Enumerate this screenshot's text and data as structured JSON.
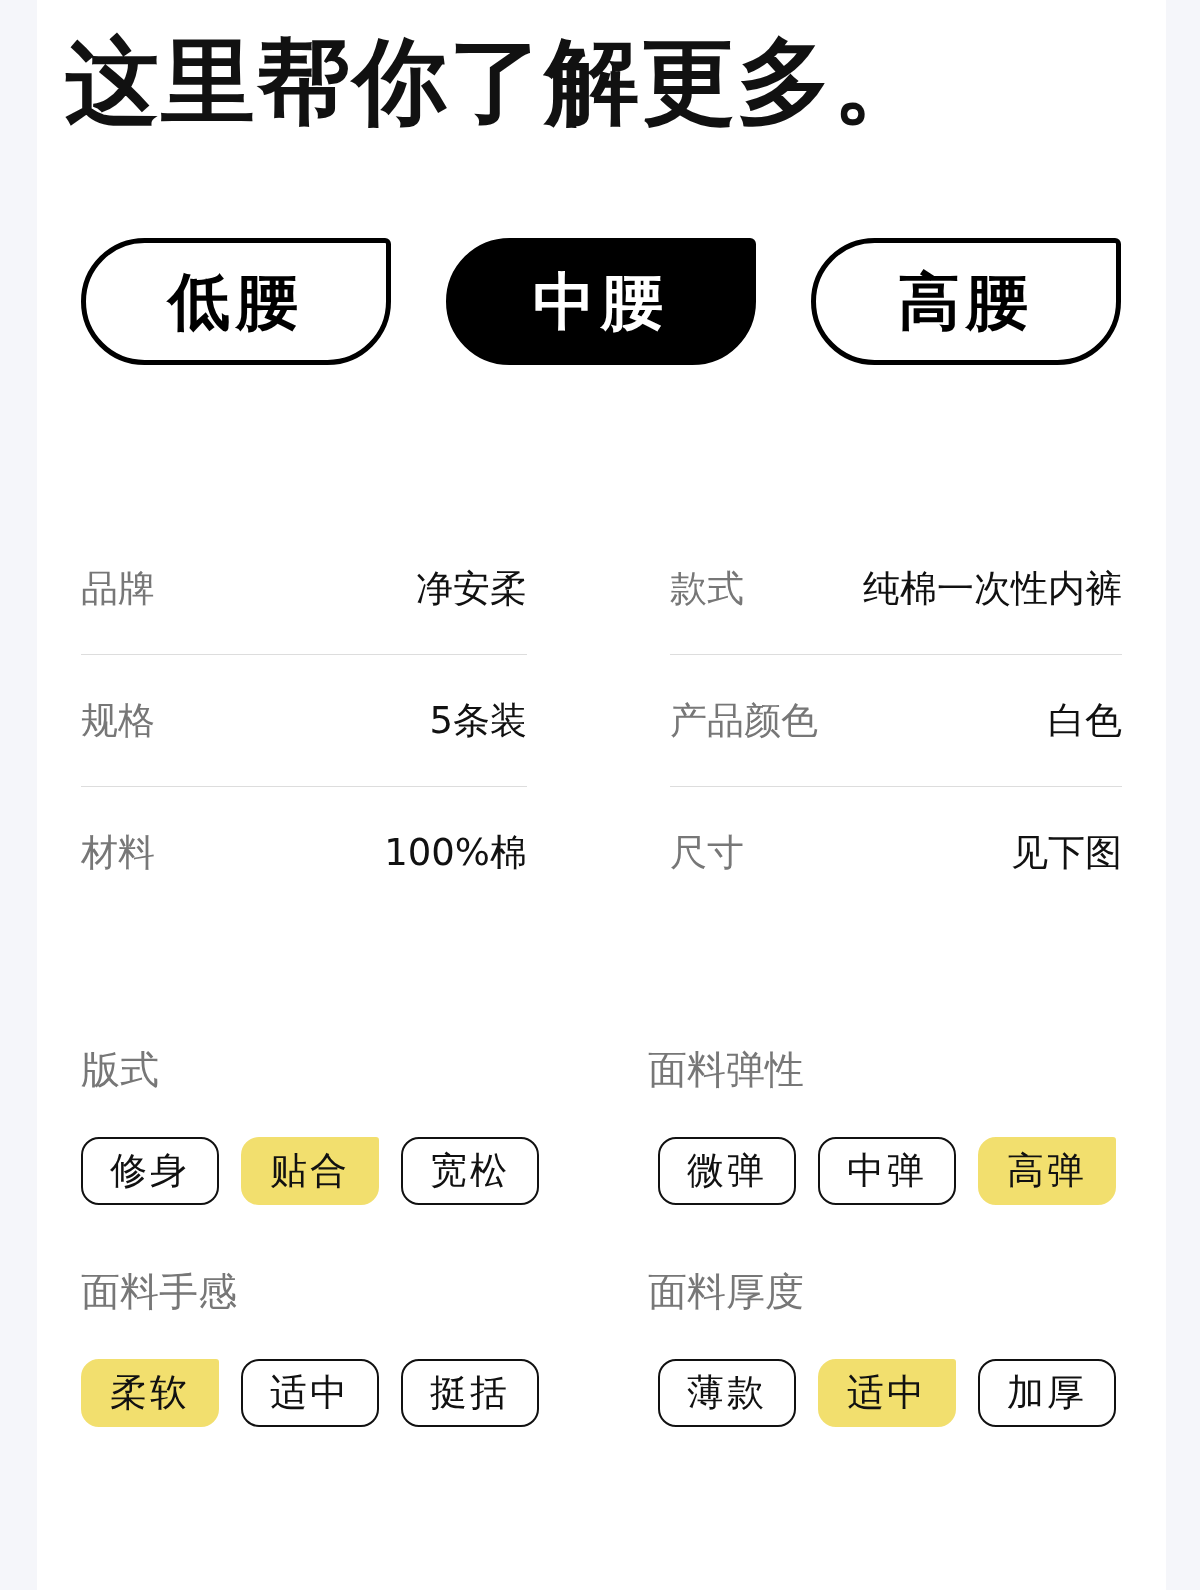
{
  "title": "这里帮你了解更多。",
  "waist_options": [
    {
      "label": "低腰",
      "selected": false
    },
    {
      "label": "中腰",
      "selected": true
    },
    {
      "label": "高腰",
      "selected": false
    }
  ],
  "specs": [
    {
      "label": "品牌",
      "value": "净安柔"
    },
    {
      "label": "款式",
      "value": "纯棉一次性内裤"
    },
    {
      "label": "规格",
      "value": "5条装"
    },
    {
      "label": "产品颜色",
      "value": "白色"
    },
    {
      "label": "材料",
      "value": "100%棉"
    },
    {
      "label": "尺寸",
      "value": "见下图"
    }
  ],
  "attributes": [
    {
      "title": "版式",
      "options": [
        {
          "label": "修身",
          "selected": false
        },
        {
          "label": "贴合",
          "selected": true
        },
        {
          "label": "宽松",
          "selected": false
        }
      ]
    },
    {
      "title": "面料弹性",
      "options": [
        {
          "label": "微弹",
          "selected": false
        },
        {
          "label": "中弹",
          "selected": false
        },
        {
          "label": "高弹",
          "selected": true
        }
      ]
    },
    {
      "title": "面料手感",
      "options": [
        {
          "label": "柔软",
          "selected": true
        },
        {
          "label": "适中",
          "selected": false
        },
        {
          "label": "挺括",
          "selected": false
        }
      ]
    },
    {
      "title": "面料厚度",
      "options": [
        {
          "label": "薄款",
          "selected": false
        },
        {
          "label": "适中",
          "selected": true
        },
        {
          "label": "加厚",
          "selected": false
        }
      ]
    }
  ]
}
